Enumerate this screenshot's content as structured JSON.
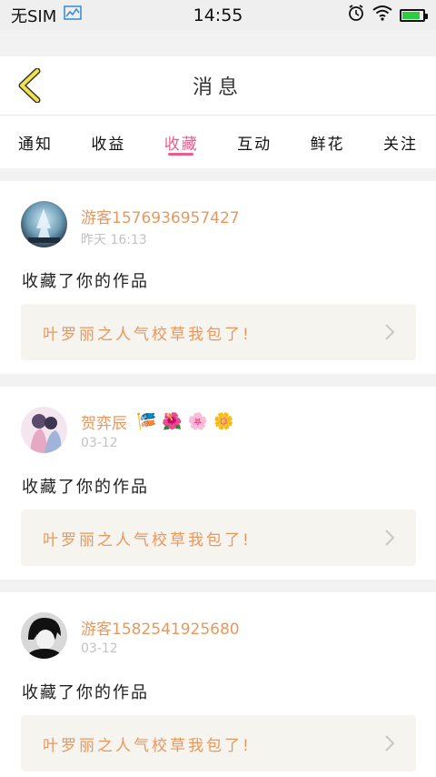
{
  "status_bar": {
    "carrier": "无SIM",
    "time": "14:55",
    "battery_level": 0.85
  },
  "header": {
    "title": "消息"
  },
  "tabs": [
    {
      "label": "通知"
    },
    {
      "label": "收益"
    },
    {
      "label": "收藏"
    },
    {
      "label": "互动"
    },
    {
      "label": "鲜花"
    },
    {
      "label": "关注"
    }
  ],
  "active_tab": "收藏",
  "items": [
    {
      "username": "游客1576936957427",
      "time": "昨天 16:13",
      "action": "收藏了你的作品",
      "work_title": "叶罗丽之人气校草我包了!",
      "flowers": []
    },
    {
      "username": "贺弈辰",
      "time": "03-12",
      "action": "收藏了你的作品",
      "work_title": "叶罗丽之人气校草我包了!",
      "flowers": [
        "🎏",
        "🌺",
        "🌸",
        "🌼"
      ]
    },
    {
      "username": "游客1582541925680",
      "time": "03-12",
      "action": "收藏了你的作品",
      "work_title": "叶罗丽之人气校草我包了!",
      "flowers": []
    }
  ],
  "colors": {
    "accent_pink": "#e85d8e",
    "username_orange": "#e8985e",
    "back_arrow_yellow": "#f2e14a"
  }
}
